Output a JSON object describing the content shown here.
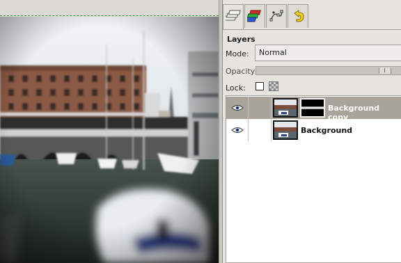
{
  "colors": {
    "dock_bg": "#e6e4df",
    "selected_row": "#a8a39b",
    "guide": "#2a9d2a"
  },
  "dock": {
    "tabs": [
      {
        "icon": "layers-icon",
        "active": true
      },
      {
        "icon": "channels-icon",
        "active": false
      },
      {
        "icon": "paths-icon",
        "active": false
      },
      {
        "icon": "undo-history-icon",
        "active": false
      }
    ]
  },
  "layers_panel": {
    "title": "Layers",
    "mode_label": "Mode:",
    "mode_value": "Normal",
    "opacity_label": "Opacity:",
    "opacity_fraction": 0.92,
    "lock_label": "Lock:",
    "layers": [
      {
        "name": "Background copy",
        "visible": true,
        "selected": true,
        "has_mask": true
      },
      {
        "name": "Background",
        "visible": true,
        "selected": false,
        "has_mask": false
      }
    ]
  }
}
